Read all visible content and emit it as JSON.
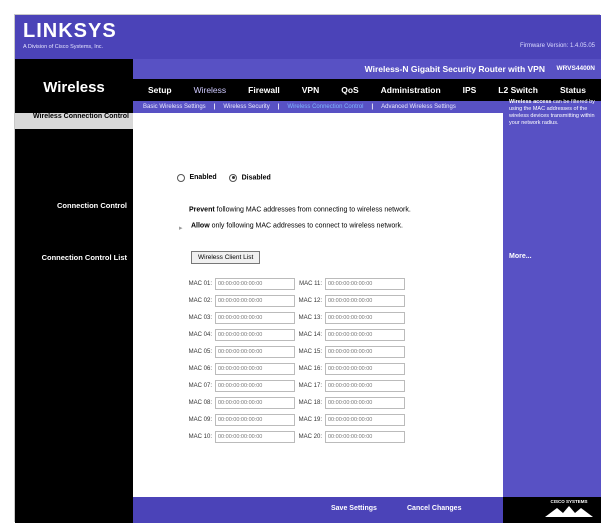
{
  "brand": {
    "logo": "LINKSYS",
    "logo_sub": "A Division of Cisco Systems, Inc.",
    "firmware": "Firmware Version: 1.4.05.05"
  },
  "product": {
    "name": "Wireless-N Gigabit Security Router with VPN",
    "model": "WRVS4400N"
  },
  "page_title": "Wireless",
  "nav": {
    "items": [
      "Setup",
      "Wireless",
      "Firewall",
      "VPN",
      "QoS",
      "Administration",
      "IPS",
      "L2 Switch",
      "Status"
    ],
    "active": "Wireless"
  },
  "subnav": {
    "items": [
      "Basic Wireless Settings",
      "Wireless Security",
      "Wireless Connection Control",
      "Advanced Wireless Settings"
    ],
    "current": "Wireless Connection Control"
  },
  "sections": {
    "connection_control_header": "Wireless Connection Control",
    "connection_control": "Connection Control",
    "connection_control_list": "Connection Control List"
  },
  "enable": {
    "enabled_label": "Enabled",
    "disabled_label": "Disabled",
    "selected": "Disabled"
  },
  "control": {
    "prevent_bold": "Prevent",
    "prevent_text": " following MAC addresses from connecting to wireless network.",
    "allow_bold": "Allow",
    "allow_text": " only following MAC addresses to connect to wireless network."
  },
  "client_list_button": "Wireless Client List",
  "mac_placeholder": "00:00:00:00:00:00",
  "mac_rows": [
    {
      "left": "MAC 01:",
      "right": "MAC 11:"
    },
    {
      "left": "MAC 02:",
      "right": "MAC 12:"
    },
    {
      "left": "MAC 03:",
      "right": "MAC 13:"
    },
    {
      "left": "MAC 04:",
      "right": "MAC 14:"
    },
    {
      "left": "MAC 05:",
      "right": "MAC 15:"
    },
    {
      "left": "MAC 06:",
      "right": "MAC 16:"
    },
    {
      "left": "MAC 07:",
      "right": "MAC 17:"
    },
    {
      "left": "MAC 08:",
      "right": "MAC 18:"
    },
    {
      "left": "MAC 09:",
      "right": "MAC 19:"
    },
    {
      "left": "MAC 10:",
      "right": "MAC 20:"
    }
  ],
  "help": {
    "bold": "Wireless access",
    "text": " can be filtered by using the MAC addresses of the wireless devices transmitting within your network radius.",
    "more": "More..."
  },
  "footer": {
    "save": "Save Settings",
    "cancel": "Cancel Changes",
    "cisco": "CISCO SYSTEMS"
  },
  "colors": {
    "brand_purple": "#4b43b8",
    "bar_purple": "#5851c4",
    "black": "#000000"
  }
}
